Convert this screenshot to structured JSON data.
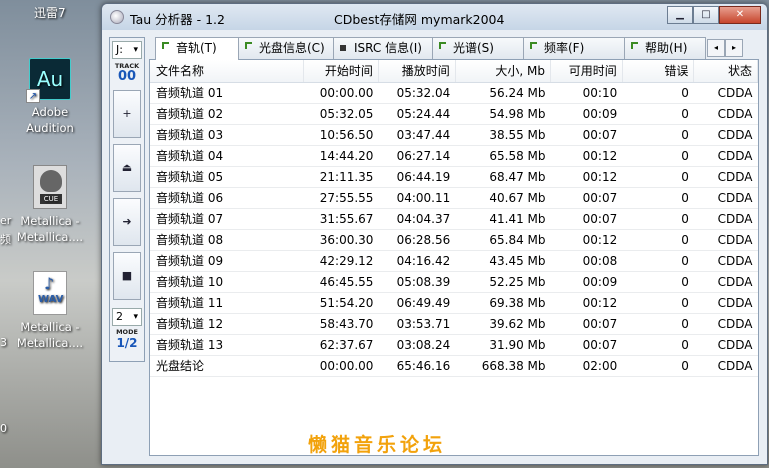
{
  "desktop": {
    "top_label": "迅雷7",
    "icons": [
      {
        "label_line1": "Adobe",
        "label_line2": "Audition",
        "pic_text": "Au"
      },
      {
        "label_line1": "Metallica -",
        "label_line2": "Metallica....",
        "pic_text": "CUE"
      },
      {
        "label_line1": "Metallica -",
        "label_line2": "Metallica....",
        "pic_text": "WAV"
      }
    ],
    "edge_texts": [
      "er",
      "频",
      "3",
      "0"
    ]
  },
  "window": {
    "title": "Tau 分析器 - 1.2",
    "subtitle": "CDbest存储网 mymark2004",
    "buttons": {
      "minimize": "▁",
      "maximize": "□",
      "close": "✕"
    }
  },
  "toolbar": {
    "drive": "J:",
    "track_label": "TRACK",
    "track_number": "00",
    "buttons": [
      "+",
      "⏏",
      "➜",
      "■"
    ],
    "mode_select": "2",
    "mode_label": "MODE",
    "mode_value": "1/2"
  },
  "tabs": [
    {
      "label": "音轨(T)",
      "indicator": "check"
    },
    {
      "label": "光盘信息(C)",
      "indicator": "check"
    },
    {
      "label": "ISRC 信息(I)",
      "indicator": "square"
    },
    {
      "label": "光谱(S)",
      "indicator": "check"
    },
    {
      "label": "频率(F)",
      "indicator": "check"
    },
    {
      "label": "帮助(H)",
      "indicator": "check"
    }
  ],
  "tab_scroll": {
    "left": "◂",
    "right": "▸"
  },
  "table": {
    "headers": [
      "文件名称",
      "开始时间",
      "播放时间",
      "大小, Mb",
      "可用时间",
      "错误",
      "状态"
    ],
    "rows": [
      [
        "音频轨道 01",
        "00:00.00",
        "05:32.04",
        "56.24 Mb",
        "00:10",
        "0",
        "CDDA"
      ],
      [
        "音频轨道 02",
        "05:32.05",
        "05:24.44",
        "54.98 Mb",
        "00:09",
        "0",
        "CDDA"
      ],
      [
        "音频轨道 03",
        "10:56.50",
        "03:47.44",
        "38.55 Mb",
        "00:07",
        "0",
        "CDDA"
      ],
      [
        "音频轨道 04",
        "14:44.20",
        "06:27.14",
        "65.58 Mb",
        "00:12",
        "0",
        "CDDA"
      ],
      [
        "音频轨道 05",
        "21:11.35",
        "06:44.19",
        "68.47 Mb",
        "00:12",
        "0",
        "CDDA"
      ],
      [
        "音频轨道 06",
        "27:55.55",
        "04:00.11",
        "40.67 Mb",
        "00:07",
        "0",
        "CDDA"
      ],
      [
        "音频轨道 07",
        "31:55.67",
        "04:04.37",
        "41.41 Mb",
        "00:07",
        "0",
        "CDDA"
      ],
      [
        "音频轨道 08",
        "36:00.30",
        "06:28.56",
        "65.84 Mb",
        "00:12",
        "0",
        "CDDA"
      ],
      [
        "音频轨道 09",
        "42:29.12",
        "04:16.42",
        "43.45 Mb",
        "00:08",
        "0",
        "CDDA"
      ],
      [
        "音频轨道 10",
        "46:45.55",
        "05:08.39",
        "52.25 Mb",
        "00:09",
        "0",
        "CDDA"
      ],
      [
        "音频轨道 11",
        "51:54.20",
        "06:49.49",
        "69.38 Mb",
        "00:12",
        "0",
        "CDDA"
      ],
      [
        "音频轨道 12",
        "58:43.70",
        "03:53.71",
        "39.62 Mb",
        "00:07",
        "0",
        "CDDA"
      ],
      [
        "音频轨道 13",
        "62:37.67",
        "03:08.24",
        "31.90 Mb",
        "00:07",
        "0",
        "CDDA"
      ]
    ],
    "summary": [
      "光盘结论",
      "00:00.00",
      "65:46.16",
      "668.38 Mb",
      "02:00",
      "0",
      "CDDA"
    ]
  },
  "watermark": "懒猫音乐论坛"
}
